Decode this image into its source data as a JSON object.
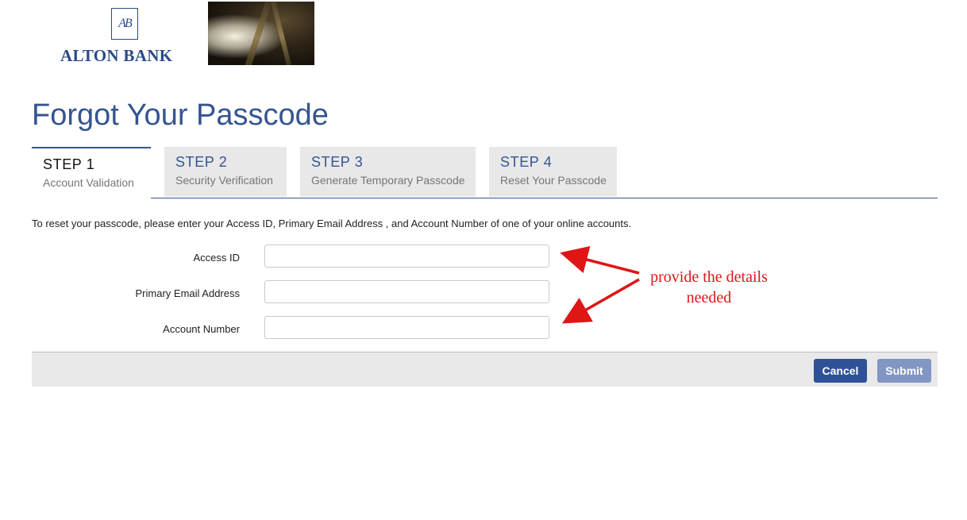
{
  "header": {
    "logo_mark": "AB",
    "bank_name": "ALTON BANK"
  },
  "page": {
    "title": "Forgot Your Passcode"
  },
  "steps": [
    {
      "title": "STEP 1",
      "subtitle": "Account Validation",
      "active": true
    },
    {
      "title": "STEP 2",
      "subtitle": "Security Verification",
      "active": false
    },
    {
      "title": "STEP 3",
      "subtitle": "Generate Temporary Passcode",
      "active": false
    },
    {
      "title": "STEP 4",
      "subtitle": "Reset Your Passcode",
      "active": false
    }
  ],
  "form": {
    "instructions": "To reset your passcode, please enter your Access ID, Primary Email Address , and Account Number of one of your online accounts.",
    "fields": [
      {
        "label": "Access ID",
        "value": ""
      },
      {
        "label": "Primary Email Address",
        "value": ""
      },
      {
        "label": "Account Number",
        "value": ""
      }
    ]
  },
  "annotation": {
    "line1": "provide the details",
    "line2": "needed",
    "color": "#e01515"
  },
  "actions": {
    "cancel_label": "Cancel",
    "submit_label": "Submit"
  },
  "colors": {
    "brand": "#35558f",
    "primary_button": "#2f5197",
    "disabled_button": "#8196c2"
  }
}
